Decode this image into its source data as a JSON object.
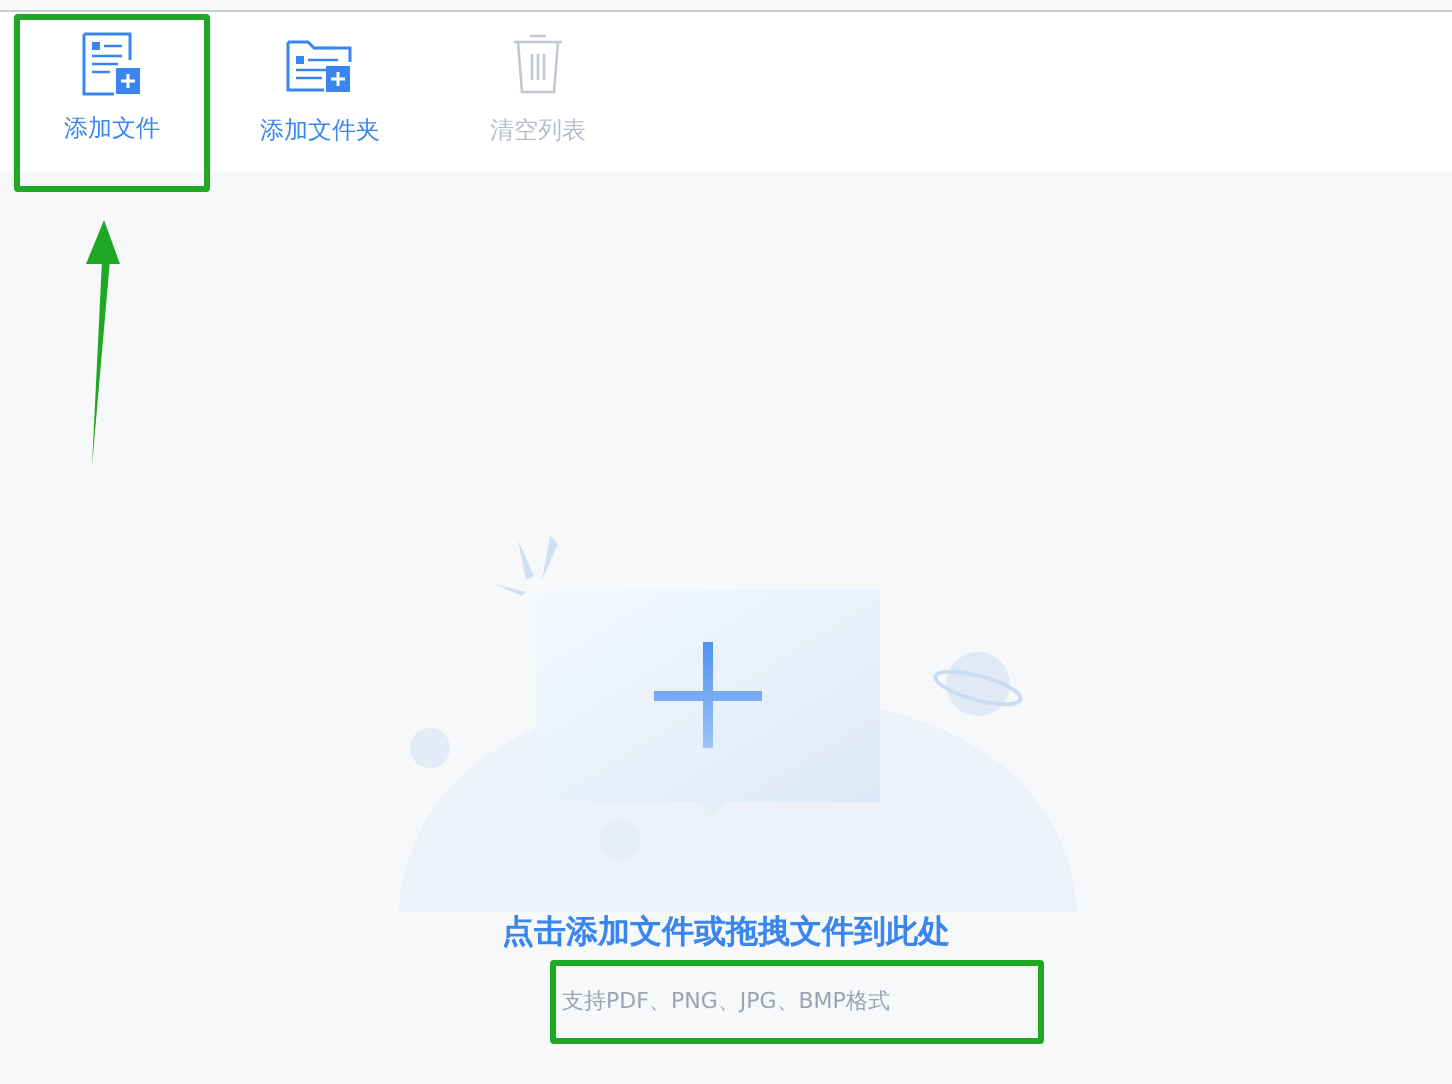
{
  "toolbar": [
    {
      "label": "添加文件",
      "kind": "file",
      "disabled": false
    },
    {
      "label": "添加文件夹",
      "kind": "folder",
      "disabled": false
    },
    {
      "label": "清空列表",
      "kind": "trash",
      "disabled": true
    }
  ],
  "drop_zone": {
    "title": "点击添加文件或拖拽文件到此处",
    "hint": "支持PDF、PNG、JPG、BMP格式"
  }
}
